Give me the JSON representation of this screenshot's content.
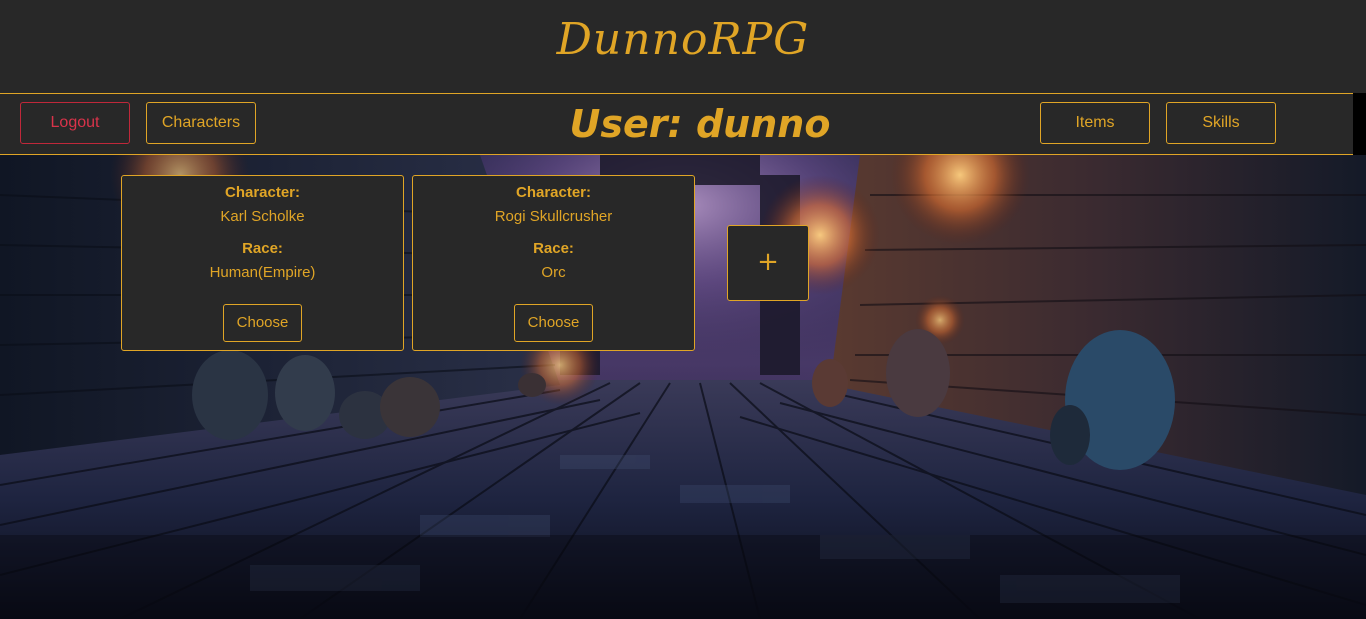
{
  "app": {
    "title": "DunnoRPG"
  },
  "nav": {
    "logout_label": "Logout",
    "characters_label": "Characters",
    "user_title": "User: dunno",
    "items_label": "Items",
    "skills_label": "Skills"
  },
  "characters": [
    {
      "character_label": "Character:",
      "name": "Karl Scholke",
      "race_label": "Race:",
      "race": "Human(Empire)",
      "choose_label": "Choose"
    },
    {
      "character_label": "Character:",
      "name": "Rogi Skullcrusher",
      "race_label": "Race:",
      "race": "Orc",
      "choose_label": "Choose"
    }
  ],
  "add_character_label": "+",
  "colors": {
    "accent": "#e0a526",
    "panel": "#282828",
    "logout": "#d9334a"
  }
}
